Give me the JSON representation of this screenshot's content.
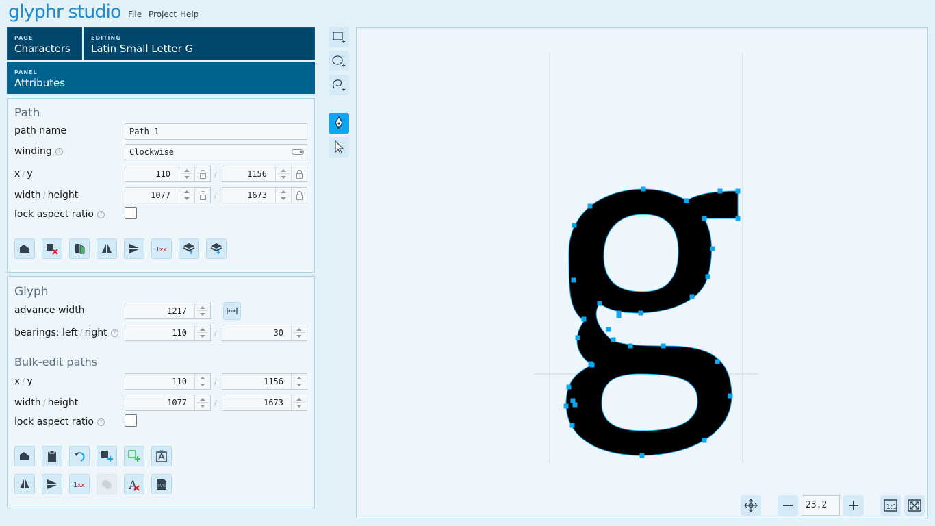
{
  "app": {
    "logo": "glyphr studio"
  },
  "menu": {
    "file": "File",
    "project": "Project",
    "help": "Help"
  },
  "nav": {
    "page_label": "PAGE",
    "page_value": "Characters",
    "editing_label": "EDITING",
    "editing_value": "Latin Small Letter G",
    "panel_label": "PANEL",
    "panel_value": "Attributes"
  },
  "path_section": {
    "title": "Path",
    "name_label": "path name",
    "name_value": "Path 1",
    "winding_label": "winding",
    "winding_value": "Clockwise",
    "xy_label_x": "x",
    "xy_label_y": "y",
    "x_value": "110",
    "y_value": "1156",
    "wh_label_w": "width",
    "wh_label_h": "height",
    "width_value": "1077",
    "height_value": "1673",
    "lock_label": "lock aspect ratio",
    "buttons": [
      "copy-icon",
      "delete-path-icon",
      "reverse-winding-icon",
      "flip-horizontal-icon",
      "flip-vertical-icon",
      "round-values-icon",
      "move-layer-up-icon",
      "move-layer-down-icon"
    ]
  },
  "glyph_section": {
    "title": "Glyph",
    "advance_label": "advance width",
    "advance_value": "1217",
    "bearings_label": "bearings: left",
    "bearings_label_right": "right",
    "bearing_left": "110",
    "bearing_right": "30"
  },
  "bulk_section": {
    "title": "Bulk-edit paths",
    "xy_label_x": "x",
    "xy_label_y": "y",
    "x_value": "110",
    "y_value": "1156",
    "wh_label_w": "width",
    "wh_label_h": "height",
    "width_value": "1077",
    "height_value": "1673",
    "lock_label": "lock aspect ratio"
  },
  "zoom": {
    "value": "23.2",
    "one_to_one": "1:1"
  },
  "colors": {
    "accent": "#0ea6ef",
    "nav_dark": "#00476b",
    "nav_mid": "#00628f",
    "point": "#0ea6ef"
  }
}
